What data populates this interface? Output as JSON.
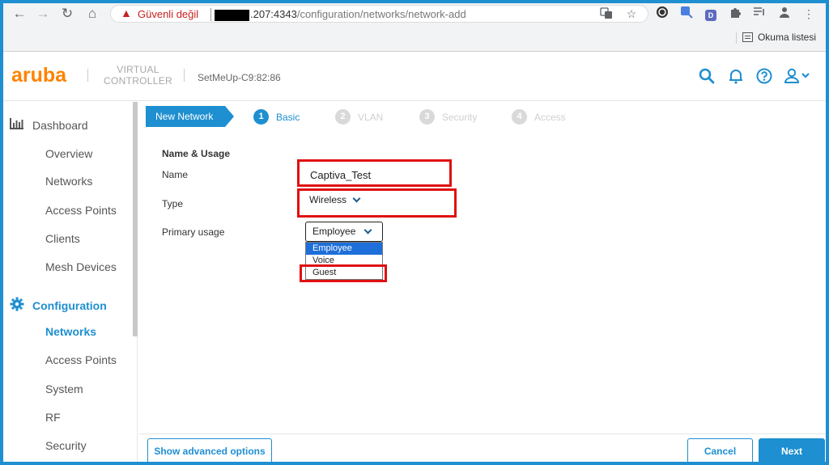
{
  "browser": {
    "security_label": "Güvenli değil",
    "url_host": ".207:4343",
    "url_path": "/configuration/networks/network-add",
    "reading_list": "Okuma listesi",
    "extension_d": "D"
  },
  "header": {
    "logo": "aruba",
    "product_line1": "VIRTUAL",
    "product_line2": "CONTROLLER",
    "device_name": "SetMeUp-C9:82:86"
  },
  "sidebar": {
    "dashboard": "Dashboard",
    "dashboard_items": [
      "Overview",
      "Networks",
      "Access Points",
      "Clients",
      "Mesh Devices"
    ],
    "configuration": "Configuration",
    "configuration_items": [
      "Networks",
      "Access Points",
      "System",
      "RF",
      "Security"
    ],
    "active_item": "Networks"
  },
  "wizard": {
    "tab": "New Network",
    "steps": [
      {
        "num": "1",
        "label": "Basic",
        "active": true
      },
      {
        "num": "2",
        "label": "VLAN",
        "active": false
      },
      {
        "num": "3",
        "label": "Security",
        "active": false
      },
      {
        "num": "4",
        "label": "Access",
        "active": false
      }
    ]
  },
  "form": {
    "section_title": "Name & Usage",
    "name_label": "Name",
    "name_value": "Captiva_Test",
    "type_label": "Type",
    "type_value": "Wireless",
    "primary_usage_label": "Primary usage",
    "primary_usage_value": "Employee",
    "primary_usage_options": [
      "Employee",
      "Voice",
      "Guest"
    ]
  },
  "footer": {
    "advanced": "Show advanced options",
    "cancel": "Cancel",
    "next": "Next"
  },
  "colors": {
    "accent": "#1e8fd0",
    "brand": "#ff8300",
    "highlight": "#e01010"
  }
}
